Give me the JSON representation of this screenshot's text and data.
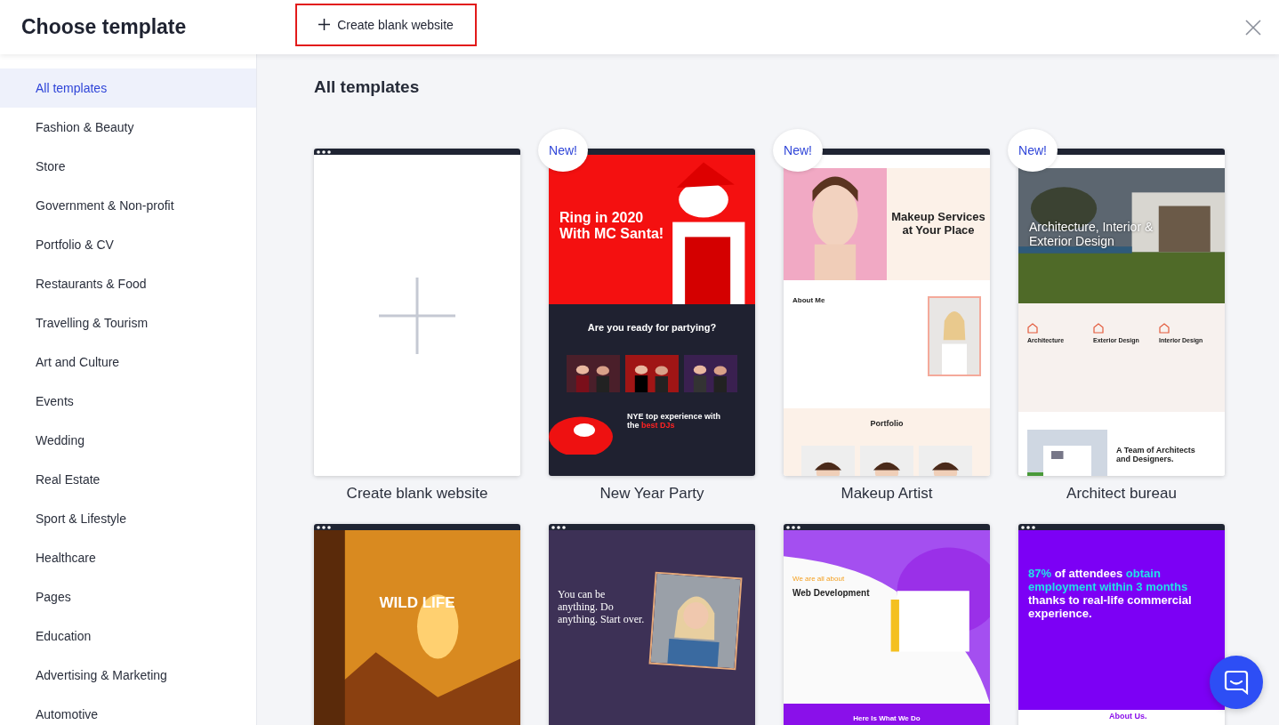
{
  "header": {
    "title": "Choose template",
    "create_button": "Create blank website"
  },
  "sidebar": {
    "items": [
      {
        "label": "All templates",
        "selected": true
      },
      {
        "label": "Fashion & Beauty",
        "selected": false
      },
      {
        "label": "Store",
        "selected": false
      },
      {
        "label": "Government & Non-profit",
        "selected": false
      },
      {
        "label": "Portfolio & CV",
        "selected": false
      },
      {
        "label": "Restaurants & Food",
        "selected": false
      },
      {
        "label": "Travelling & Tourism",
        "selected": false
      },
      {
        "label": "Art and Culture",
        "selected": false
      },
      {
        "label": "Events",
        "selected": false
      },
      {
        "label": "Wedding",
        "selected": false
      },
      {
        "label": "Real Estate",
        "selected": false
      },
      {
        "label": "Sport & Lifestyle",
        "selected": false
      },
      {
        "label": "Healthcare",
        "selected": false
      },
      {
        "label": "Pages",
        "selected": false
      },
      {
        "label": "Education",
        "selected": false
      },
      {
        "label": "Advertising & Marketing",
        "selected": false
      },
      {
        "label": "Automotive",
        "selected": false
      }
    ]
  },
  "main": {
    "heading": "All templates",
    "templates": [
      {
        "kind": "blank",
        "name": "Create blank website"
      },
      {
        "kind": "party",
        "name": "New Year Party",
        "badge": "New!",
        "headlines": [
          [
            {
              "text": "Ring in 2020 With MC Santa!",
              "accent": false
            }
          ],
          [
            {
              "text": "Are you ready for partying?",
              "accent": false
            }
          ],
          [
            {
              "text": "NYE top experience with the ",
              "accent": false
            },
            {
              "text": "best DJs",
              "accent": true
            }
          ]
        ]
      },
      {
        "kind": "makeup",
        "name": "Makeup Artist",
        "badge": "New!",
        "headlines": [
          [
            {
              "text": "Makeup Services at Your Place",
              "accent": false
            }
          ],
          [
            {
              "text": "About Me",
              "accent": false
            }
          ],
          [
            {
              "text": "Portfolio",
              "accent": false
            }
          ]
        ]
      },
      {
        "kind": "architect",
        "name": "Architect bureau",
        "badge": "New!",
        "headlines": [
          [
            {
              "text": "Architecture, Interior & Exterior Design",
              "accent": false
            }
          ],
          [
            {
              "text": "Architecture",
              "accent": false
            }
          ],
          [
            {
              "text": "Exterior Design",
              "accent": false
            }
          ],
          [
            {
              "text": "Interior Design",
              "accent": false
            }
          ],
          [
            {
              "text": "A Team of Architects and Designers.",
              "accent": false
            }
          ]
        ]
      },
      {
        "kind": "wildlife",
        "headlines": [
          [
            {
              "text": "WILD LIFE",
              "accent": false
            }
          ]
        ]
      },
      {
        "kind": "coach",
        "headlines": [
          [
            {
              "text": "You can be anything. Do anything. Start over.",
              "accent": false
            }
          ]
        ]
      },
      {
        "kind": "digital",
        "headlines": [
          [
            {
              "text": "We are all about",
              "accent": false
            }
          ],
          [
            {
              "text": "Web Development",
              "accent": false
            }
          ],
          [
            {
              "text": "Here Is What We Do",
              "accent": false
            }
          ]
        ]
      },
      {
        "kind": "academy",
        "headlines": [
          [
            {
              "text": "87%",
              "accent": true
            },
            {
              "text": " of attendees ",
              "accent": false
            },
            {
              "text": "obtain employment within 3 months",
              "accent": true
            },
            {
              "text": " thanks to real-life commercial experience.",
              "accent": false
            }
          ],
          [
            {
              "text": "About Us.",
              "accent": false
            }
          ]
        ]
      }
    ]
  }
}
